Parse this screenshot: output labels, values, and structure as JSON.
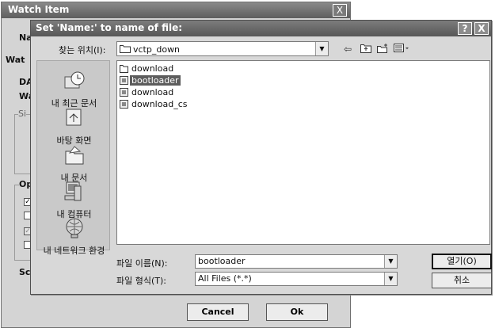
{
  "background_dialog": {
    "title": "Watch Item",
    "close_glyph": "X",
    "labels": [
      "Na",
      "Wat",
      "DA",
      "Wa",
      "Si",
      "Op",
      "Sc"
    ],
    "cancel_label": "Cancel",
    "ok_label": "Ok"
  },
  "dialog": {
    "title": "Set 'Name:' to name of file:",
    "help_glyph": "?",
    "close_glyph": "X",
    "lookin_label": "찾는 위치(I):",
    "lookin_value": "vctp_down",
    "places": [
      "내 최근 문서",
      "바탕 화면",
      "내 문서",
      "내 컴퓨터",
      "내 네트워크 환경"
    ],
    "files": [
      {
        "name": "download",
        "icon": "folder-icon",
        "selected": false
      },
      {
        "name": "bootloader",
        "icon": "file-icon",
        "selected": true
      },
      {
        "name": "download",
        "icon": "file-icon",
        "selected": false
      },
      {
        "name": "download_cs",
        "icon": "file-icon",
        "selected": false
      }
    ],
    "filename_label": "파일 이름(N):",
    "filename_value": "bootloader",
    "filetype_label": "파일 형식(T):",
    "filetype_value": "All Files (*.*)",
    "open_label": "열기(O)",
    "cancel_label": "취소"
  }
}
